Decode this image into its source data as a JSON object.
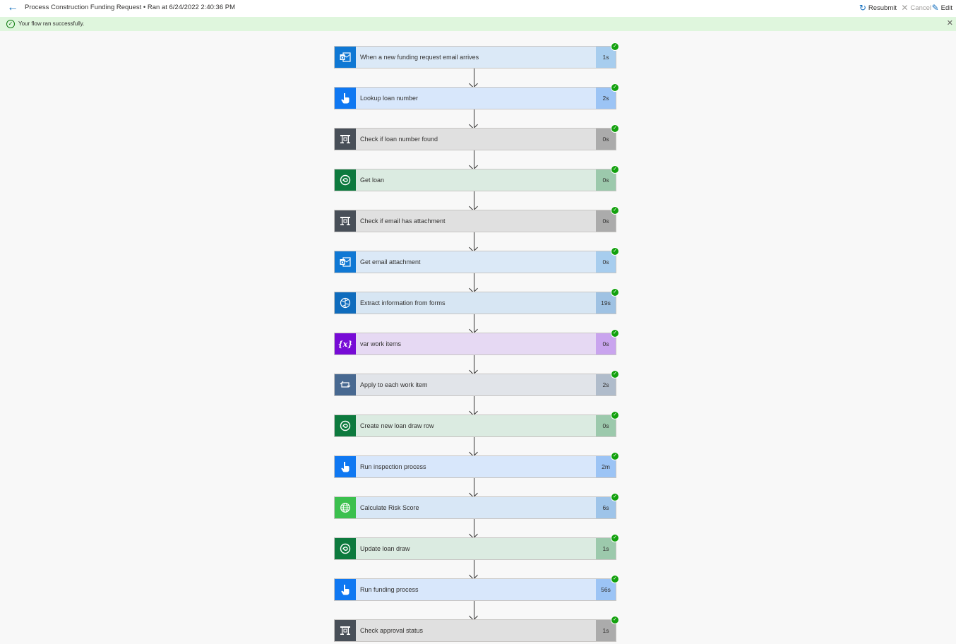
{
  "header": {
    "title": "Process Construction Funding Request • Ran at 6/24/2022 2:40:36 PM",
    "actions": {
      "resubmit": "Resubmit",
      "cancel": "Cancel",
      "edit": "Edit"
    }
  },
  "banner": {
    "message": "Your flow ran successfully.",
    "status_color": "#dff6dd"
  },
  "steps": [
    {
      "label": "When a new funding request email arrives",
      "duration": "1s",
      "icon": "outlook-icon",
      "status": "succeeded"
    },
    {
      "label": "Lookup loan number",
      "duration": "2s",
      "icon": "flow-trigger-icon",
      "status": "succeeded"
    },
    {
      "label": "Check if loan number found",
      "duration": "0s",
      "icon": "condition-icon",
      "status": "succeeded"
    },
    {
      "label": "Get loan",
      "duration": "0s",
      "icon": "dataverse-icon",
      "status": "succeeded"
    },
    {
      "label": "Check if email has attachment",
      "duration": "0s",
      "icon": "condition-icon",
      "status": "succeeded"
    },
    {
      "label": "Get email attachment",
      "duration": "0s",
      "icon": "outlook-icon",
      "status": "succeeded"
    },
    {
      "label": "Extract information from forms",
      "duration": "19s",
      "icon": "ai-builder-icon",
      "status": "succeeded"
    },
    {
      "label": "var work items",
      "duration": "0s",
      "icon": "variable-icon",
      "status": "succeeded"
    },
    {
      "label": "Apply to each work item",
      "duration": "2s",
      "icon": "loop-icon",
      "status": "succeeded"
    },
    {
      "label": "Create new loan draw row",
      "duration": "0s",
      "icon": "dataverse-icon",
      "status": "succeeded"
    },
    {
      "label": "Run inspection process",
      "duration": "2m",
      "icon": "flow-trigger-icon",
      "status": "succeeded"
    },
    {
      "label": "Calculate Risk Score",
      "duration": "6s",
      "icon": "http-globe-icon",
      "status": "succeeded"
    },
    {
      "label": "Update loan draw",
      "duration": "1s",
      "icon": "dataverse-icon",
      "status": "succeeded"
    },
    {
      "label": "Run funding process",
      "duration": "56s",
      "icon": "flow-trigger-icon",
      "status": "succeeded"
    },
    {
      "label": "Check approval status",
      "duration": "1s",
      "icon": "condition-icon",
      "status": "succeeded"
    }
  ],
  "colors": {
    "accent": "#0f6cbd",
    "success": "#13a10e"
  }
}
